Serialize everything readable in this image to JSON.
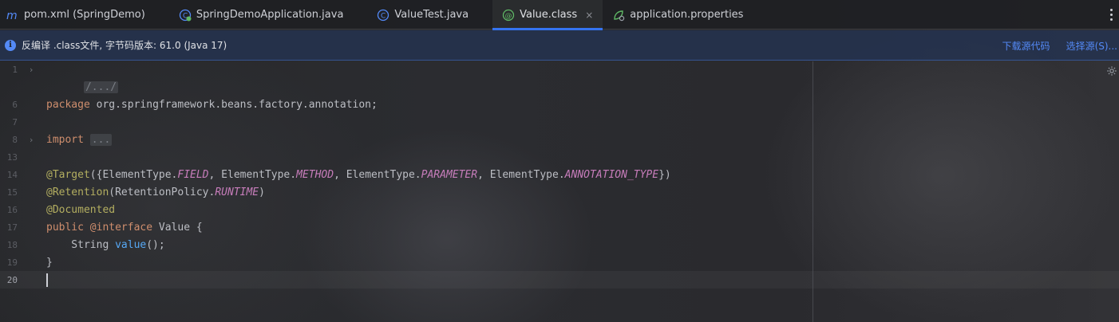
{
  "tabs": [
    {
      "label": "pom.xml (SpringDemo)",
      "icon": "maven-icon",
      "active": false
    },
    {
      "label": "SpringDemoApplication.java",
      "icon": "spring-class-icon",
      "active": false
    },
    {
      "label": "ValueTest.java",
      "icon": "class-icon",
      "active": false
    },
    {
      "label": "Value.class",
      "icon": "annotation-icon",
      "active": true,
      "close": "×"
    },
    {
      "label": "application.properties",
      "icon": "spring-properties-icon",
      "active": false
    }
  ],
  "banner": {
    "icon": "info-icon",
    "icon_glyph": "i",
    "text": "反编译 .class文件, 字节码版本: 61.0 (Java 17)",
    "download_sources": "下载源代码",
    "choose_sources": "选择源(S)..."
  },
  "editor": {
    "line_numbers": [
      "1",
      "6",
      "7",
      "8",
      "13",
      "14",
      "15",
      "16",
      "17",
      "18",
      "19",
      "20"
    ],
    "current_line": "20",
    "lines": {
      "l1_folded": "/.../",
      "l6_kw": "package",
      "l6_rest": " org.springframework.beans.factory.annotation;",
      "l8_kw": "import",
      "l8_folded": "...",
      "l14_ann": "@Target",
      "l14_a": "({ElementType.",
      "l14_c1": "FIELD",
      "l14_b": ", ElementType.",
      "l14_c2": "METHOD",
      "l14_d": ", ElementType.",
      "l14_c3": "PARAMETER",
      "l14_e": ", ElementType.",
      "l14_c4": "ANNOTATION_TYPE",
      "l14_f": "})",
      "l15_ann": "@Retention",
      "l15_a": "(RetentionPolicy.",
      "l15_c": "RUNTIME",
      "l15_b": ")",
      "l16_ann": "@Documented",
      "l17_kw1": "public",
      "l17_ann": " @interface",
      "l17_rest": " Value {",
      "l18_type": "    String ",
      "l18_method": "value",
      "l18_rest": "();",
      "l19": "}"
    }
  },
  "colors": {
    "accent": "#3574f0",
    "keyword": "#cf8e6d",
    "annotation": "#b3ae60",
    "constant": "#c77dbb",
    "method": "#56a8f5",
    "link": "#548af7"
  }
}
